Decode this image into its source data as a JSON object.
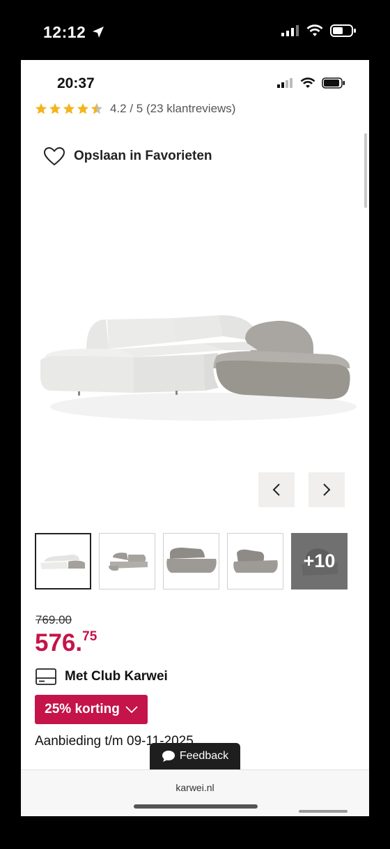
{
  "outer_status": {
    "time": "12:12",
    "location_icon": "location-arrow-icon",
    "signal_icon": "cellular-signal-icon",
    "wifi_icon": "wifi-icon",
    "battery_icon": "battery-icon"
  },
  "inner_status": {
    "time": "20:37",
    "signal_icon": "cellular-signal-icon",
    "wifi_icon": "wifi-icon",
    "battery_icon": "battery-icon"
  },
  "rating": {
    "stars": 4.2,
    "text": "4.2 / 5 (23 klantreviews)",
    "star_color": "#f2b51d"
  },
  "favorite": {
    "icon": "heart-icon",
    "label": "Opslaan in Favorieten"
  },
  "gallery": {
    "prev_icon": "chevron-left-icon",
    "next_icon": "chevron-right-icon",
    "thumbnails": [
      {
        "name": "thumbnail-corner-sofa",
        "active": true
      },
      {
        "name": "thumbnail-sofa-angle"
      },
      {
        "name": "thumbnail-sofa-module"
      },
      {
        "name": "thumbnail-chair-module"
      }
    ],
    "more_label": "+10"
  },
  "pricing": {
    "old_price": "769.00",
    "price_main": "576.",
    "price_cents": "75",
    "accent_color": "#c4144a"
  },
  "club": {
    "icon": "card-icon",
    "label": "Met Club Karwei"
  },
  "discount": {
    "label": "25% korting",
    "icon": "chevron-down-icon"
  },
  "offer_text": "Aanbieding t/m 09-11-2025",
  "feedback": {
    "icon": "chat-bubble-icon",
    "label": "Feedback"
  },
  "browser": {
    "url": "karwei.nl"
  }
}
